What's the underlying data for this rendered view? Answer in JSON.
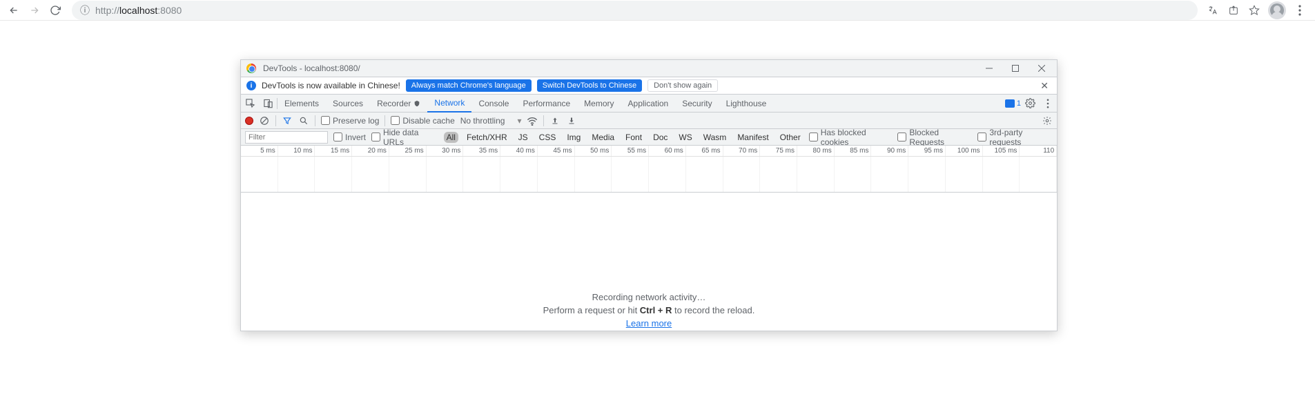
{
  "browser": {
    "url_display_main": "localhost",
    "url_display_port": ":8080",
    "url_prefix": "http://"
  },
  "devtools": {
    "title": "DevTools - localhost:8080/",
    "banner": {
      "message": "DevTools is now available in Chinese!",
      "btn_match": "Always match Chrome's language",
      "btn_switch": "Switch DevTools to Chinese",
      "btn_dont": "Don't show again"
    },
    "tabs": {
      "elements": "Elements",
      "sources": "Sources",
      "recorder": "Recorder",
      "network": "Network",
      "console": "Console",
      "performance": "Performance",
      "memory": "Memory",
      "application": "Application",
      "security": "Security",
      "lighthouse": "Lighthouse"
    },
    "issues_count": "1",
    "toolbar": {
      "preserve_log": "Preserve log",
      "disable_cache": "Disable cache",
      "throttling": "No throttling"
    },
    "filter": {
      "placeholder": "Filter",
      "invert": "Invert",
      "hide_data_urls": "Hide data URLs",
      "types": {
        "all": "All",
        "fetch": "Fetch/XHR",
        "js": "JS",
        "css": "CSS",
        "img": "Img",
        "media": "Media",
        "font": "Font",
        "doc": "Doc",
        "ws": "WS",
        "wasm": "Wasm",
        "manifest": "Manifest",
        "other": "Other"
      },
      "blocked_cookies": "Has blocked cookies",
      "blocked_requests": "Blocked Requests",
      "third_party": "3rd-party requests"
    },
    "timeline_ticks": [
      "5 ms",
      "10 ms",
      "15 ms",
      "20 ms",
      "25 ms",
      "30 ms",
      "35 ms",
      "40 ms",
      "45 ms",
      "50 ms",
      "55 ms",
      "60 ms",
      "65 ms",
      "70 ms",
      "75 ms",
      "80 ms",
      "85 ms",
      "90 ms",
      "95 ms",
      "100 ms",
      "105 ms",
      "110"
    ],
    "empty": {
      "title": "Recording network activity…",
      "hint_before": "Perform a request or hit ",
      "hint_shortcut": "Ctrl + R",
      "hint_after": " to record the reload.",
      "learn_more": "Learn more"
    }
  }
}
